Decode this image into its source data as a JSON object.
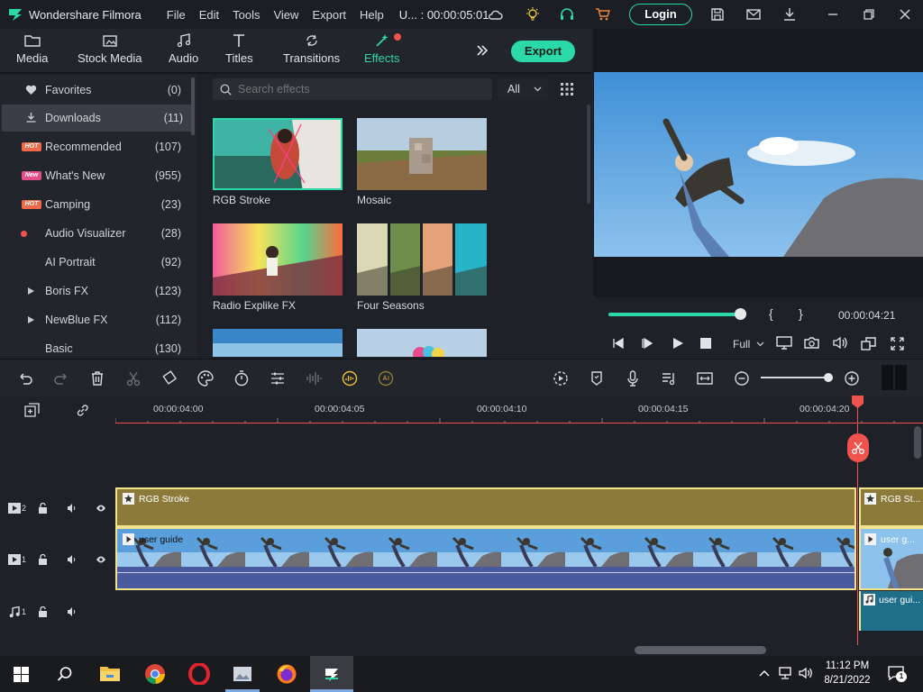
{
  "app": {
    "name": "Wondershare Filmora",
    "project": "U... : 00:00:05:01",
    "login": "Login"
  },
  "menu": [
    "File",
    "Edit",
    "Tools",
    "View",
    "Export",
    "Help"
  ],
  "media_tabs": [
    "Media",
    "Stock Media",
    "Audio",
    "Titles",
    "Transitions",
    "Effects"
  ],
  "export_label": "Export",
  "sidebar": [
    {
      "label": "Favorites",
      "count": "(0)"
    },
    {
      "label": "Downloads",
      "count": "(11)"
    },
    {
      "label": "Recommended",
      "count": "(107)",
      "badge": "HOT"
    },
    {
      "label": "What's New",
      "count": "(955)",
      "badge": "New"
    },
    {
      "label": "Camping",
      "count": "(23)",
      "badge": "HOT"
    },
    {
      "label": "Audio Visualizer",
      "count": "(28)"
    },
    {
      "label": "AI Portrait",
      "count": "(92)"
    },
    {
      "label": "Boris FX",
      "count": "(123)"
    },
    {
      "label": "NewBlue FX",
      "count": "(112)"
    },
    {
      "label": "Basic",
      "count": "(130)"
    }
  ],
  "search": {
    "placeholder": "Search effects",
    "filter": "All"
  },
  "effects": [
    {
      "label": "RGB Stroke"
    },
    {
      "label": "Mosaic"
    },
    {
      "label": "Radio Explike FX"
    },
    {
      "label": "Four Seasons"
    }
  ],
  "player": {
    "timecode": "00:00:04:21",
    "quality": "Full",
    "progress": 0.97
  },
  "timeline": {
    "ticks": [
      "00:00:04:00",
      "00:00:04:05",
      "00:00:04:10",
      "00:00:04:15",
      "00:00:04:20"
    ],
    "tracks": [
      {
        "num": "2"
      },
      {
        "num": "1"
      },
      {
        "num": "1"
      }
    ],
    "effect_clip": "RGB Stroke",
    "effect_clip2": "RGB St...",
    "video_clip": "user guide",
    "video_clip2": "user g...",
    "audio_clip": "user gui..."
  },
  "taskbar": {
    "time": "11:12 PM",
    "date": "8/21/2022",
    "notif": "1"
  },
  "colors": {
    "accent": "#2bd8a8",
    "playhead": "#f0524d",
    "effect_track": "#8c7a3a",
    "audio_track": "#1f6f8b"
  }
}
